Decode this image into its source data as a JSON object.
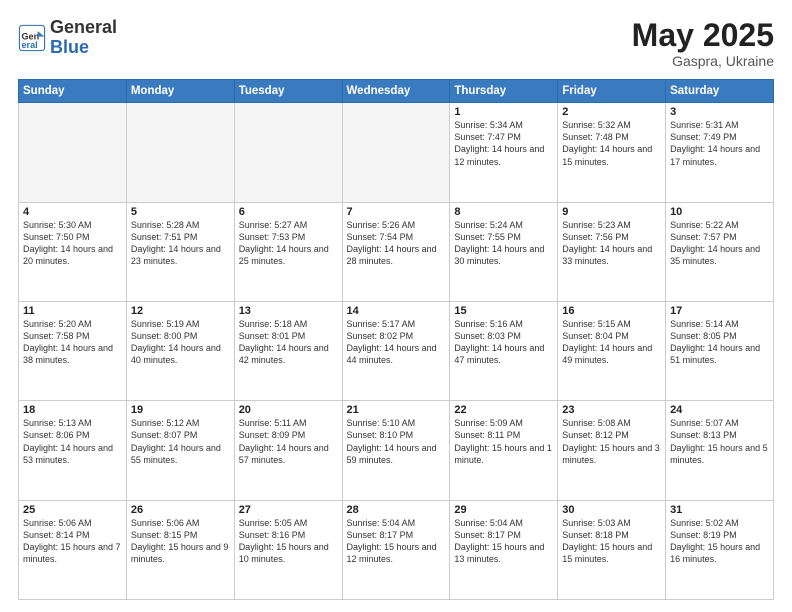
{
  "header": {
    "logo_general": "General",
    "logo_blue": "Blue",
    "month_year": "May 2025",
    "location": "Gaspra, Ukraine"
  },
  "weekdays": [
    "Sunday",
    "Monday",
    "Tuesday",
    "Wednesday",
    "Thursday",
    "Friday",
    "Saturday"
  ],
  "weeks": [
    [
      {
        "day": "",
        "info": "",
        "empty": true
      },
      {
        "day": "",
        "info": "",
        "empty": true
      },
      {
        "day": "",
        "info": "",
        "empty": true
      },
      {
        "day": "",
        "info": "",
        "empty": true
      },
      {
        "day": "1",
        "info": "Sunrise: 5:34 AM\nSunset: 7:47 PM\nDaylight: 14 hours\nand 12 minutes."
      },
      {
        "day": "2",
        "info": "Sunrise: 5:32 AM\nSunset: 7:48 PM\nDaylight: 14 hours\nand 15 minutes."
      },
      {
        "day": "3",
        "info": "Sunrise: 5:31 AM\nSunset: 7:49 PM\nDaylight: 14 hours\nand 17 minutes."
      }
    ],
    [
      {
        "day": "4",
        "info": "Sunrise: 5:30 AM\nSunset: 7:50 PM\nDaylight: 14 hours\nand 20 minutes."
      },
      {
        "day": "5",
        "info": "Sunrise: 5:28 AM\nSunset: 7:51 PM\nDaylight: 14 hours\nand 23 minutes."
      },
      {
        "day": "6",
        "info": "Sunrise: 5:27 AM\nSunset: 7:53 PM\nDaylight: 14 hours\nand 25 minutes."
      },
      {
        "day": "7",
        "info": "Sunrise: 5:26 AM\nSunset: 7:54 PM\nDaylight: 14 hours\nand 28 minutes."
      },
      {
        "day": "8",
        "info": "Sunrise: 5:24 AM\nSunset: 7:55 PM\nDaylight: 14 hours\nand 30 minutes."
      },
      {
        "day": "9",
        "info": "Sunrise: 5:23 AM\nSunset: 7:56 PM\nDaylight: 14 hours\nand 33 minutes."
      },
      {
        "day": "10",
        "info": "Sunrise: 5:22 AM\nSunset: 7:57 PM\nDaylight: 14 hours\nand 35 minutes."
      }
    ],
    [
      {
        "day": "11",
        "info": "Sunrise: 5:20 AM\nSunset: 7:58 PM\nDaylight: 14 hours\nand 38 minutes."
      },
      {
        "day": "12",
        "info": "Sunrise: 5:19 AM\nSunset: 8:00 PM\nDaylight: 14 hours\nand 40 minutes."
      },
      {
        "day": "13",
        "info": "Sunrise: 5:18 AM\nSunset: 8:01 PM\nDaylight: 14 hours\nand 42 minutes."
      },
      {
        "day": "14",
        "info": "Sunrise: 5:17 AM\nSunset: 8:02 PM\nDaylight: 14 hours\nand 44 minutes."
      },
      {
        "day": "15",
        "info": "Sunrise: 5:16 AM\nSunset: 8:03 PM\nDaylight: 14 hours\nand 47 minutes."
      },
      {
        "day": "16",
        "info": "Sunrise: 5:15 AM\nSunset: 8:04 PM\nDaylight: 14 hours\nand 49 minutes."
      },
      {
        "day": "17",
        "info": "Sunrise: 5:14 AM\nSunset: 8:05 PM\nDaylight: 14 hours\nand 51 minutes."
      }
    ],
    [
      {
        "day": "18",
        "info": "Sunrise: 5:13 AM\nSunset: 8:06 PM\nDaylight: 14 hours\nand 53 minutes."
      },
      {
        "day": "19",
        "info": "Sunrise: 5:12 AM\nSunset: 8:07 PM\nDaylight: 14 hours\nand 55 minutes."
      },
      {
        "day": "20",
        "info": "Sunrise: 5:11 AM\nSunset: 8:09 PM\nDaylight: 14 hours\nand 57 minutes."
      },
      {
        "day": "21",
        "info": "Sunrise: 5:10 AM\nSunset: 8:10 PM\nDaylight: 14 hours\nand 59 minutes."
      },
      {
        "day": "22",
        "info": "Sunrise: 5:09 AM\nSunset: 8:11 PM\nDaylight: 15 hours\nand 1 minute."
      },
      {
        "day": "23",
        "info": "Sunrise: 5:08 AM\nSunset: 8:12 PM\nDaylight: 15 hours\nand 3 minutes."
      },
      {
        "day": "24",
        "info": "Sunrise: 5:07 AM\nSunset: 8:13 PM\nDaylight: 15 hours\nand 5 minutes."
      }
    ],
    [
      {
        "day": "25",
        "info": "Sunrise: 5:06 AM\nSunset: 8:14 PM\nDaylight: 15 hours\nand 7 minutes."
      },
      {
        "day": "26",
        "info": "Sunrise: 5:06 AM\nSunset: 8:15 PM\nDaylight: 15 hours\nand 9 minutes."
      },
      {
        "day": "27",
        "info": "Sunrise: 5:05 AM\nSunset: 8:16 PM\nDaylight: 15 hours\nand 10 minutes."
      },
      {
        "day": "28",
        "info": "Sunrise: 5:04 AM\nSunset: 8:17 PM\nDaylight: 15 hours\nand 12 minutes."
      },
      {
        "day": "29",
        "info": "Sunrise: 5:04 AM\nSunset: 8:17 PM\nDaylight: 15 hours\nand 13 minutes."
      },
      {
        "day": "30",
        "info": "Sunrise: 5:03 AM\nSunset: 8:18 PM\nDaylight: 15 hours\nand 15 minutes."
      },
      {
        "day": "31",
        "info": "Sunrise: 5:02 AM\nSunset: 8:19 PM\nDaylight: 15 hours\nand 16 minutes."
      }
    ]
  ]
}
